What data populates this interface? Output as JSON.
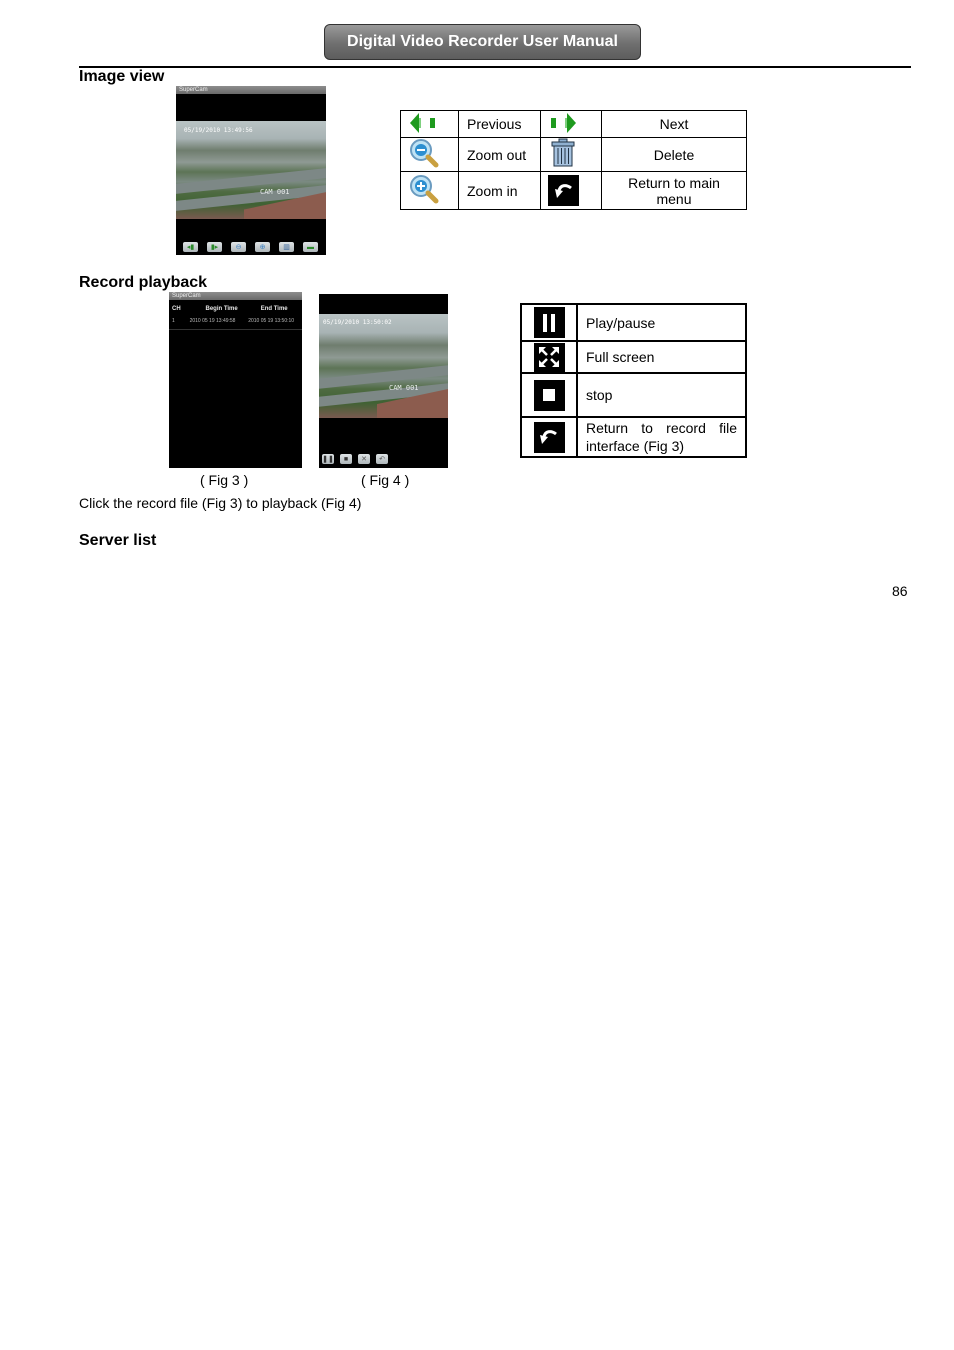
{
  "header": {
    "title": "Digital Video Recorder User Manual"
  },
  "sections": {
    "image_view": {
      "heading": "Image view",
      "screenshot": {
        "app_name": "SuperCam",
        "timestamp_osd": "05/19/2010 13:49:56",
        "camera_osd": "CAM 001",
        "toolbar_icons": [
          "previous-icon",
          "next-icon",
          "zoom-out-icon",
          "zoom-in-icon",
          "delete-icon",
          "return-icon"
        ]
      },
      "legend": [
        {
          "icon": "previous-icon",
          "label": "Previous",
          "icon2": "next-icon",
          "label2": "Next"
        },
        {
          "icon": "zoom-out-icon",
          "label": "Zoom out",
          "icon2": "delete-icon",
          "label2": "Delete"
        },
        {
          "icon": "zoom-in-icon",
          "label": "Zoom in",
          "icon2": "return-icon",
          "label2": "Return to main menu"
        }
      ]
    },
    "record_playback": {
      "heading": "Record playback",
      "fig3": {
        "app_name": "SuperCam",
        "columns": [
          "CH",
          "Begin Time",
          "End Time"
        ],
        "rows": [
          {
            "ch": "1",
            "begin": "2010 05 19 13:49:58",
            "end": "2010 05 19 13:50:10"
          }
        ],
        "caption": "( Fig 3 )"
      },
      "fig4": {
        "timestamp_osd": "05/19/2010 13:50:02",
        "camera_osd": "CAM 001",
        "toolbar_icons": [
          "pause-icon",
          "stop-icon",
          "fullscreen-icon",
          "return-icon"
        ],
        "caption": "( Fig 4 )"
      },
      "legend": [
        {
          "icon": "pause-icon",
          "label": "Play/pause"
        },
        {
          "icon": "fullscreen-icon",
          "label": "Full screen"
        },
        {
          "icon": "stop-icon",
          "label": "stop"
        },
        {
          "icon": "return-icon",
          "label": "Return to record file interface (Fig 3)"
        }
      ],
      "note": "Click the record file (Fig 3) to playback (Fig 4)"
    },
    "server_list": {
      "heading": "Server list"
    }
  },
  "footer": {
    "page_number": "86"
  },
  "colors": {
    "banner_top": "#9a9a9a",
    "banner_bottom": "#5d5d5d",
    "arrow_green": "#1e9a1e"
  }
}
